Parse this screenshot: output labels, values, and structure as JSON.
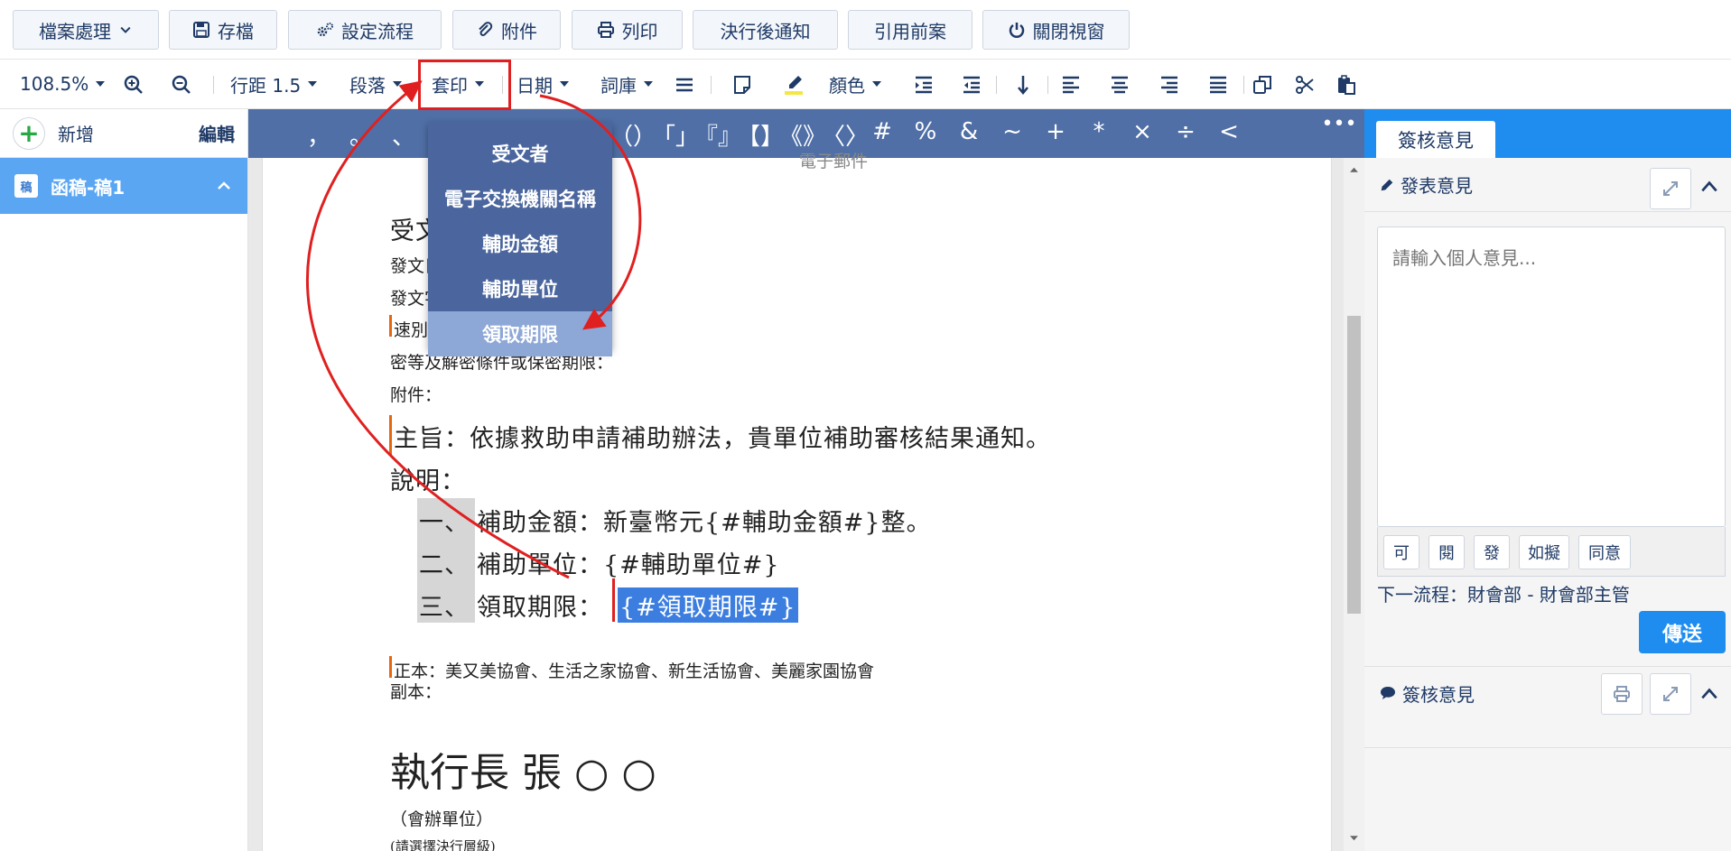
{
  "topbar": {
    "file_menu": "檔案處理",
    "save": "存檔",
    "flow": "設定流程",
    "attach": "附件",
    "print": "列印",
    "notify": "決行後通知",
    "cite": "引用前案",
    "close": "關閉視窗"
  },
  "toolbar": {
    "zoom": "108.5%",
    "line_spacing": "行距 1.5",
    "paragraph": "段落",
    "template": "套印",
    "date": "日期",
    "phrases": "詞庫",
    "color": "顏色"
  },
  "sidebar": {
    "add": "新增",
    "edit": "編輯",
    "doc_badge": "稿",
    "doc_item": "函稿-稿1"
  },
  "symbols": [
    "，",
    "。",
    "、",
    "（）",
    "「」",
    "『』",
    "【】",
    "《》",
    "〈〉",
    "#",
    "%",
    "&",
    "~",
    "+",
    "*",
    "×",
    "÷",
    "<"
  ],
  "template_menu": {
    "items": [
      "受文者",
      "電子交換機關名稱",
      "輔助金額",
      "輔助單位",
      "領取期限"
    ],
    "active_index": 4
  },
  "document": {
    "top_fragment": "電子郵件",
    "recipient": "受文者",
    "date_line": "發文日期：    年    月    日",
    "number_line": "發文字號：                                號",
    "speed": "速別",
    "secrecy": "密等及解密條件或保密期限：",
    "attachment": "附件：",
    "subject": "主旨：依據救助申請補助辦法，貴單位補助審核結果通知。",
    "explain": "說明：",
    "item1_num": "一、",
    "item1": "補助金額：新臺幣元{#輔助金額#}整。",
    "item2_num": "二、",
    "item2": "補助單位：{#輔助單位#}",
    "item3_num": "三、",
    "item3_label": "領取期限：",
    "item3_value": "{#領取期限#}",
    "copies_main": "正本：美又美協會、生活之家協會、新生活協會、美麗家園協會",
    "copies_sub": "副本：",
    "signature": "執行長 張 ○ ○",
    "co_unit": "（會辦單位）",
    "level": "(請選擇決行層級)"
  },
  "right_panel": {
    "tab": "簽核意見",
    "publish": "發表意見",
    "placeholder": "請輸入個人意見...",
    "quick": [
      "可",
      "閱",
      "發",
      "如擬",
      "同意"
    ],
    "next_flow": "下一流程：財會部 - 財會部主管",
    "send": "傳送",
    "opinions": "簽核意見"
  },
  "colors": {
    "accent": "#1f8df0",
    "symbar": "#4f6fa6",
    "menu": "#4b669e",
    "menu_active": "#8da7d6",
    "sidebar_active": "#5aa6f3",
    "annotation_red": "#e02020"
  }
}
